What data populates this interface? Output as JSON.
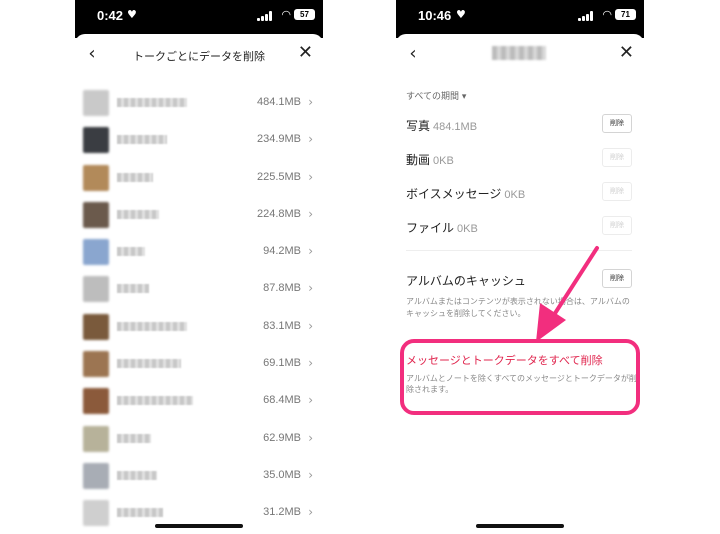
{
  "left": {
    "status": {
      "time": "0:42",
      "battery": "57"
    },
    "nav": {
      "title": "トークごとにデータを削除"
    },
    "talks": [
      {
        "size": "484.1MB",
        "avatar": "#c9c9c9",
        "name_w": 70
      },
      {
        "size": "234.9MB",
        "avatar": "#3a3d42",
        "name_w": 50
      },
      {
        "size": "225.5MB",
        "avatar": "#b28a5a",
        "name_w": 36
      },
      {
        "size": "224.8MB",
        "avatar": "#6b5a4c",
        "name_w": 42
      },
      {
        "size": "94.2MB",
        "avatar": "#8aa6cf",
        "name_w": 28
      },
      {
        "size": "87.8MB",
        "avatar": "#bdbdbd",
        "name_w": 32
      },
      {
        "size": "83.1MB",
        "avatar": "#7a5a3c",
        "name_w": 70
      },
      {
        "size": "69.1MB",
        "avatar": "#9c7552",
        "name_w": 64
      },
      {
        "size": "68.4MB",
        "avatar": "#8b5a3b",
        "name_w": 76
      },
      {
        "size": "62.9MB",
        "avatar": "#b7b29a",
        "name_w": 34
      },
      {
        "size": "35.0MB",
        "avatar": "#a8adb5",
        "name_w": 40
      },
      {
        "size": "31.2MB",
        "avatar": "#cfcfcf",
        "name_w": 46
      }
    ]
  },
  "right": {
    "status": {
      "time": "10:46",
      "battery": "71"
    },
    "period_label": "すべての期間 ▾",
    "rows": [
      {
        "label": "写真",
        "size": "484.1MB",
        "button": "削除",
        "enabled": true
      },
      {
        "label": "動画",
        "size": "0KB",
        "button": "削除",
        "enabled": false
      },
      {
        "label": "ボイスメッセージ",
        "size": "0KB",
        "button": "削除",
        "enabled": false
      },
      {
        "label": "ファイル",
        "size": "0KB",
        "button": "削除",
        "enabled": false
      }
    ],
    "album": {
      "label": "アルバムのキャッシュ",
      "button": "削除",
      "desc": "アルバムまたはコンテンツが表示されない場合は、アルバムのキャッシュを削除してください。"
    },
    "delete_all": {
      "title": "メッセージとトークデータをすべて削除",
      "desc": "アルバムとノートを除くすべてのメッセージとトークデータが削除されます。"
    }
  },
  "annotation": {
    "color": "#f22e7e"
  }
}
